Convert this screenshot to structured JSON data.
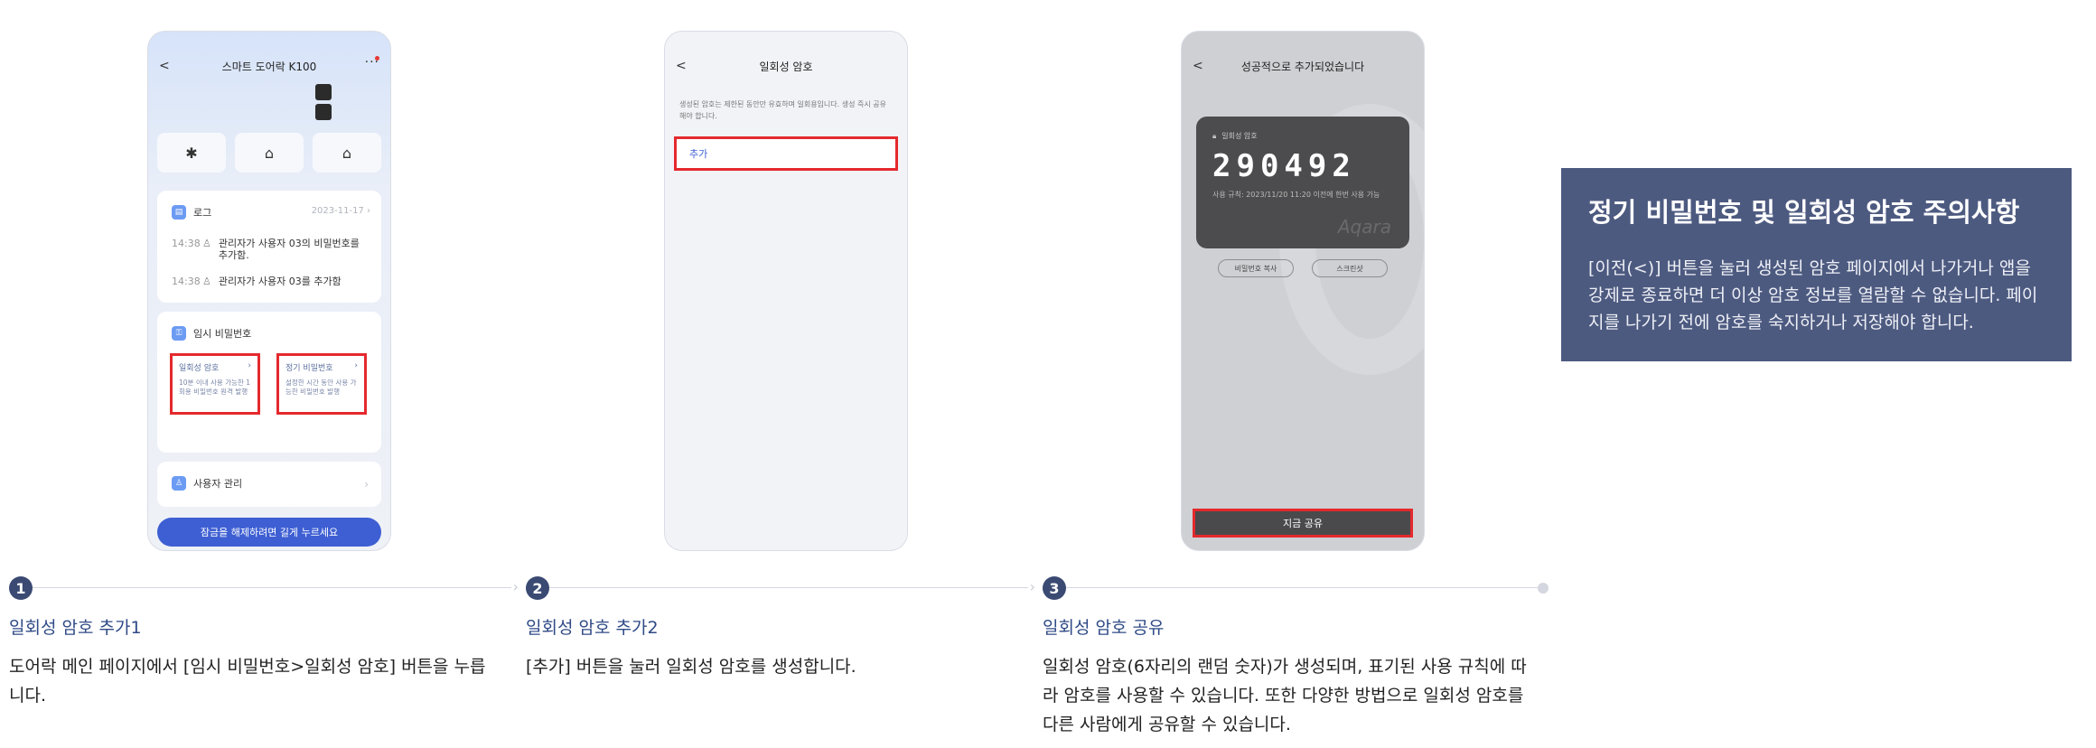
{
  "screen1": {
    "title": "스마트 도어락 K100",
    "back_icon": "chevron-left-icon",
    "more_icon": "more-dots-icon",
    "quick_actions": [
      {
        "icon": "bluetooth-icon",
        "glyph": "✱"
      },
      {
        "icon": "gateway-icon",
        "glyph": "⌂"
      },
      {
        "icon": "home-icon",
        "glyph": "⌂"
      }
    ],
    "log": {
      "label": "로그",
      "date": "2023-11-17",
      "entries": [
        {
          "time": "14:38",
          "text": "관리자가 사용자 03의 비밀번호를 추가함."
        },
        {
          "time": "14:38",
          "text": "관리자가 사용자 03를 추가함"
        }
      ]
    },
    "temp_password": {
      "label": "임시 비밀번호",
      "options": [
        {
          "title": "일회성 암호",
          "desc": "10분 이내 사용 가능한 1회용 비밀번호 원격 발행"
        },
        {
          "title": "정기 비밀번호",
          "desc": "설정한 시간 동안 사용 가능한 비밀번호 발행"
        }
      ]
    },
    "user_manage_label": "사용자 관리",
    "unlock_label": "잠금을 해제하려면 길게 누르세요"
  },
  "screen2": {
    "title": "일회성 암호",
    "description": "생성된 암호는 제한된 동안만 유효하며 일회용입니다. 생성 즉시 공유해야 합니다.",
    "add_label": "추가"
  },
  "screen3": {
    "title": "성공적으로 추가되었습니다",
    "card_label": "일회성 암호",
    "code": "290492",
    "rule": "사용 규칙: 2023/11/20 11:20 이전에 한번 사용 가능",
    "brand": "Aqara",
    "copy_label": "비밀번호 복사",
    "screenshot_label": "스크린샷",
    "share_label": "지금 공유"
  },
  "steps": [
    {
      "num": "1",
      "title": "일회성 암호 추가1",
      "desc": "도어락 메인 페이지에서 [임시 비밀번호>일회성 암호] 버튼을 누릅니다."
    },
    {
      "num": "2",
      "title": "일회성 암호 추가2",
      "desc": "[추가] 버튼을 눌러 일회성 암호를 생성합니다."
    },
    {
      "num": "3",
      "title": "일회성 암호 공유",
      "desc": "일회성 암호(6자리의 랜덤 숫자)가 생성되며, 표기된 사용 규칙에 따라 암호를 사용할 수 있습니다. 또한 다양한 방법으로 일회성 암호를 다른 사람에게 공유할 수 있습니다."
    }
  ],
  "notice": {
    "title": "정기 비밀번호 및 일회성 암호 주의사항",
    "body": "[이전(<)] 버튼을 눌러 생성된 암호 페이지에서 나가거나 앱을 강제로 종료하면 더 이상 암호 정보를 열람할 수 없습니다. 페이지를 나가기 전에 암호를 숙지하거나 저장해야 합니다."
  },
  "colors": {
    "highlight": "#e4292d",
    "accent": "#3e5fd3",
    "step_title": "#2f4a86",
    "notice_bg": "#4d5a80"
  }
}
